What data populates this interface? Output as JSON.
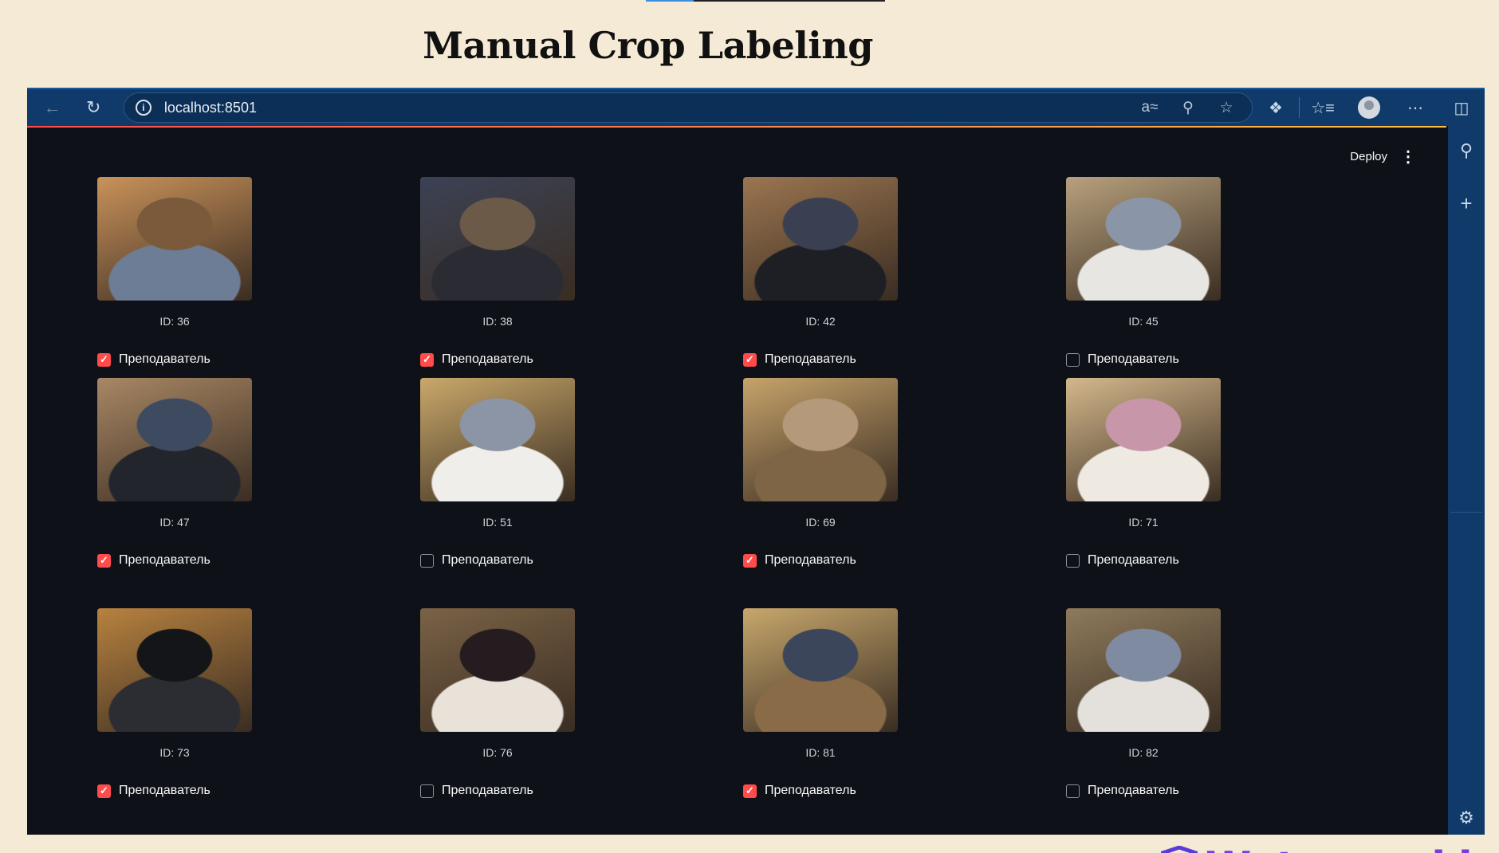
{
  "slide": {
    "title": "Manual Crop Labeling"
  },
  "browser": {
    "url": "localhost:8501",
    "icons": [
      "back-arrow-icon",
      "reload-icon",
      "info-icon",
      "translate-icon",
      "zoom-out-icon",
      "favorite-star-icon",
      "extensions-icon",
      "favorites-list-icon",
      "profile-avatar-icon",
      "more-icon",
      "sidebar-toggle-icon"
    ]
  },
  "app": {
    "deploy_label": "Deploy",
    "checkbox_label": "Преподаватель",
    "accent_color": "#ff4b4b",
    "background_color": "#0e1117",
    "crops": [
      {
        "id_label": "ID: 36",
        "checked": true
      },
      {
        "id_label": "ID: 38",
        "checked": true
      },
      {
        "id_label": "ID: 42",
        "checked": true
      },
      {
        "id_label": "ID: 45",
        "checked": false
      },
      {
        "id_label": "ID: 47",
        "checked": true
      },
      {
        "id_label": "ID: 51",
        "checked": false
      },
      {
        "id_label": "ID: 69",
        "checked": true
      },
      {
        "id_label": "ID: 71",
        "checked": false
      },
      {
        "id_label": "ID: 73",
        "checked": true
      },
      {
        "id_label": "ID: 76",
        "checked": false
      },
      {
        "id_label": "ID: 81",
        "checked": true
      },
      {
        "id_label": "ID: 82",
        "checked": false
      }
    ]
  },
  "watermark": {
    "text": "Watermarkly"
  }
}
